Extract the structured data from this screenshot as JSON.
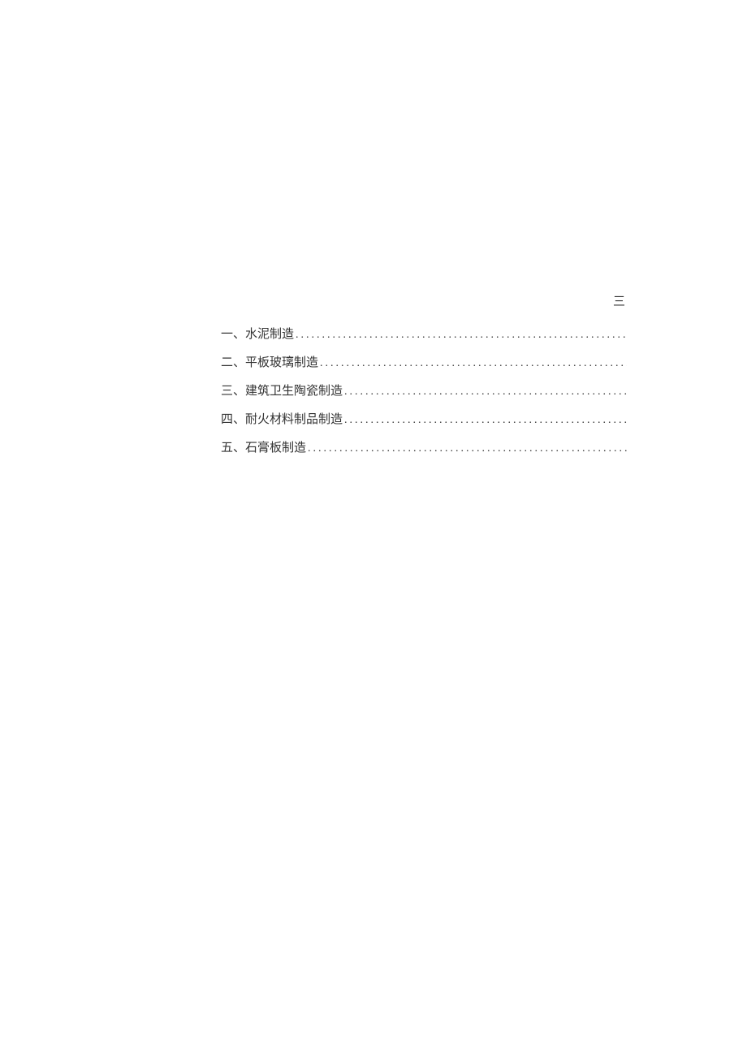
{
  "page_mark": "三",
  "toc": {
    "entries": [
      {
        "label": "一、水泥制造"
      },
      {
        "label": "二、平板玻璃制造"
      },
      {
        "label": "三、建筑卫生陶瓷制造"
      },
      {
        "label": "四、耐火材料制品制造"
      },
      {
        "label": "五、石膏板制造"
      }
    ]
  }
}
